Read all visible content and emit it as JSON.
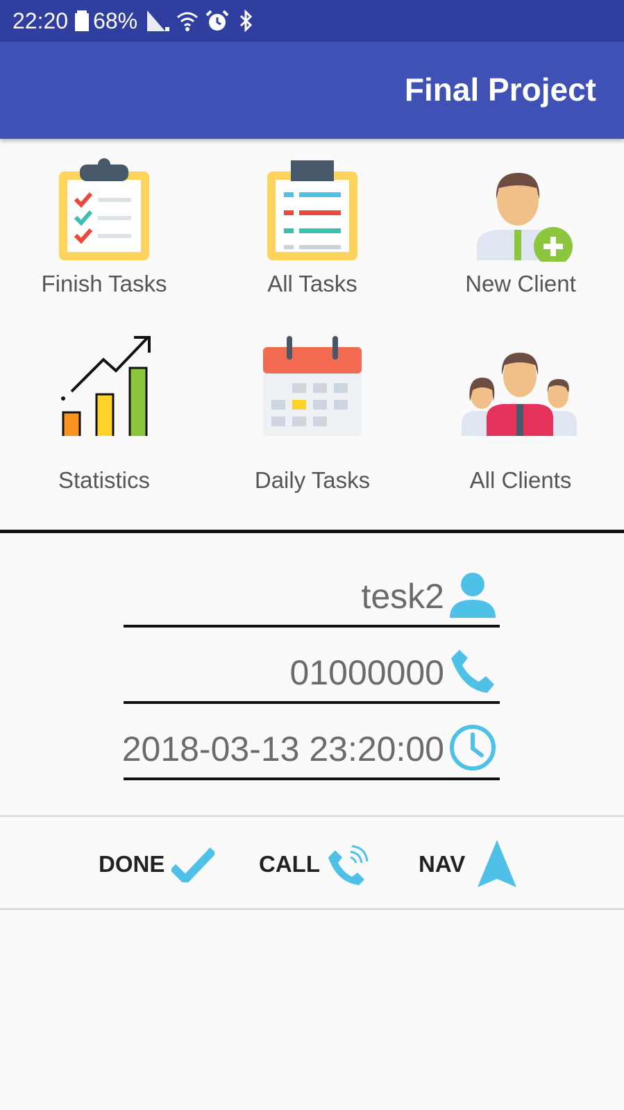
{
  "status_bar": {
    "time": "22:20",
    "battery": "68%",
    "icons": [
      "battery-icon",
      "signal-icon",
      "wifi-icon",
      "alarm-icon",
      "bluetooth-icon"
    ]
  },
  "app_bar": {
    "title": "Final Project"
  },
  "menu": {
    "items": [
      {
        "label": "Finish Tasks",
        "icon": "clipboard-checklist-icon"
      },
      {
        "label": "All Tasks",
        "icon": "clipboard-list-icon"
      },
      {
        "label": "New Client",
        "icon": "add-user-icon"
      },
      {
        "label": "Statistics",
        "icon": "bar-chart-growth-icon"
      },
      {
        "label": "Daily Tasks",
        "icon": "calendar-icon"
      },
      {
        "label": "All Clients",
        "icon": "people-group-icon"
      }
    ]
  },
  "task": {
    "name": "tesk2",
    "phone": "01000000",
    "datetime": "2018-03-13 23:20:00"
  },
  "actions": {
    "done": "DONE",
    "call": "CALL",
    "nav": "NAV"
  },
  "colors": {
    "status_bar": "#303f9f",
    "app_bar": "#3f51b5",
    "accent_icon": "#4fc0e8",
    "background": "#fafafa"
  }
}
